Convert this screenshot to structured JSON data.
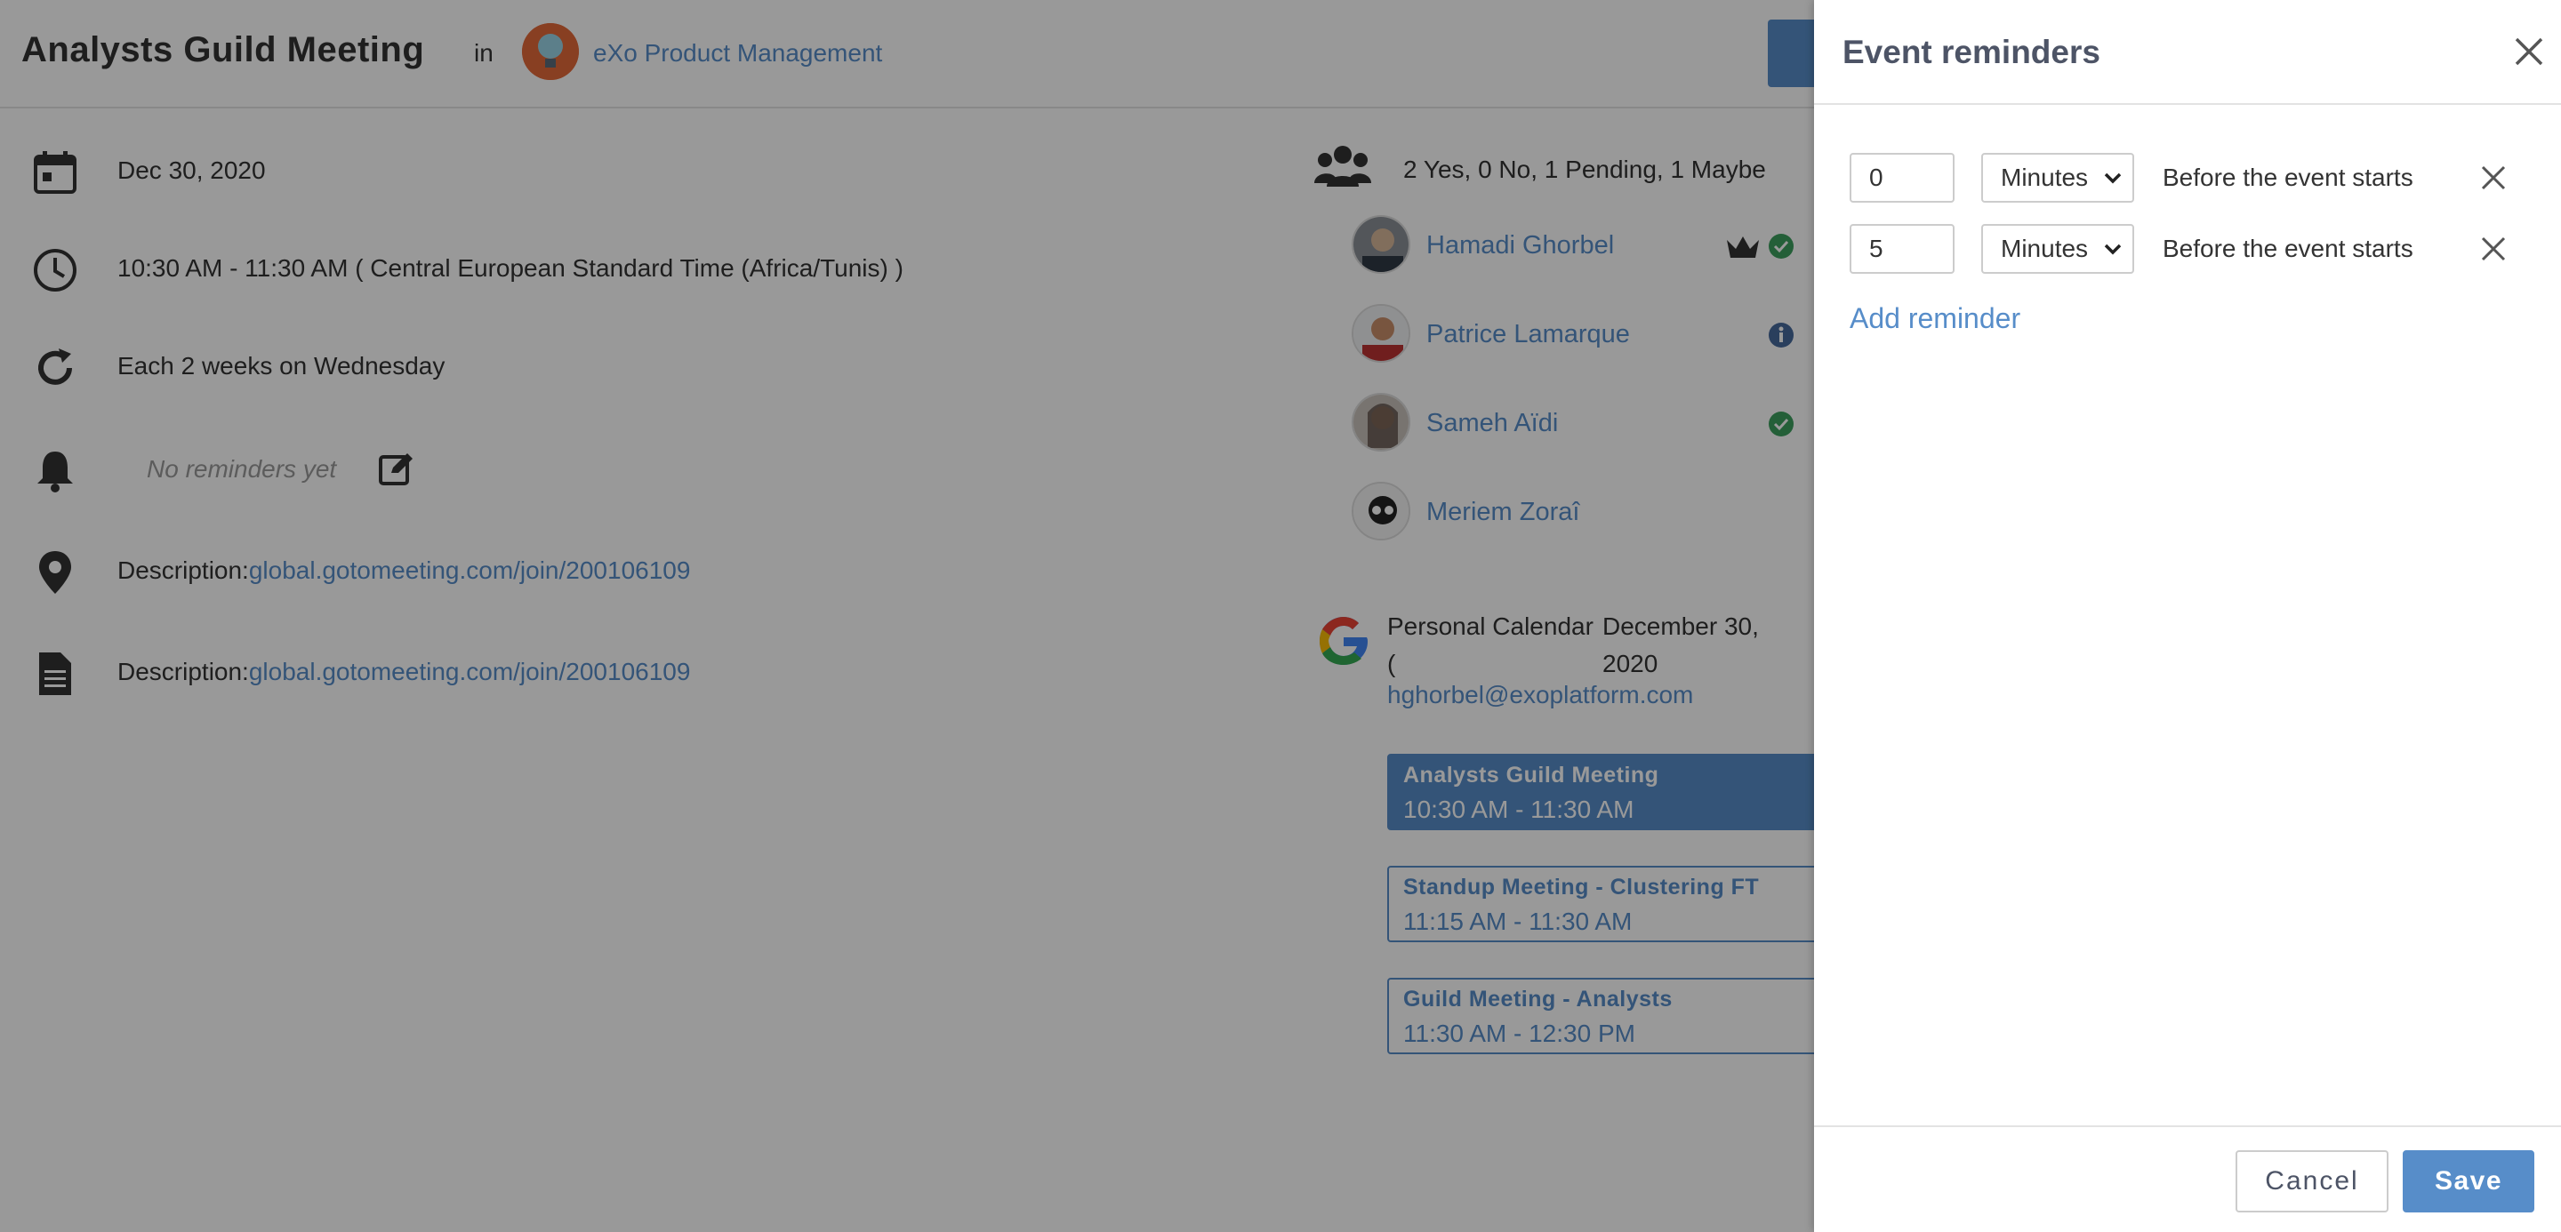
{
  "event": {
    "title": "Analysts Guild Meeting",
    "in_word": "in",
    "space_name": "eXo Product Management",
    "date": "Dec 30, 2020",
    "time": "10:30 AM - 11:30 AM  ( Central European Standard Time (Africa/Tunis) )",
    "recurrence": "Each 2 weeks on Wednesday",
    "no_reminders": "No reminders yet",
    "location_label": "Description:",
    "location_link": "global.gotomeeting.com/join/200106109",
    "description_label": "Description:",
    "description_link": "global.gotomeeting.com/join/200106109"
  },
  "attendees": {
    "summary": "2 Yes, 0 No, 1 Pending, 1 Maybe",
    "list": [
      {
        "name": "Hamadi Ghorbel",
        "status": "yes",
        "organizer": true
      },
      {
        "name": "Patrice Lamarque",
        "status": "maybe",
        "organizer": false
      },
      {
        "name": "Sameh Aïdi",
        "status": "yes",
        "organizer": false
      },
      {
        "name": "Meriem Zoraî",
        "status": "pending",
        "organizer": false
      }
    ]
  },
  "personal_calendar": {
    "name_line1": "Personal Calendar",
    "name_line2": "(",
    "date_line1": "December 30,",
    "date_line2": "2020",
    "email": "hghorbel@exoplatform.com",
    "events": [
      {
        "title": "Analysts Guild Meeting",
        "time": "10:30 AM - 11:30 AM",
        "active": true
      },
      {
        "title": "Standup Meeting - Clustering FT",
        "time": "11:15 AM - 11:30 AM",
        "active": false
      },
      {
        "title": "Guild Meeting - Analysts",
        "time": "11:30 AM - 12:30 PM",
        "active": false
      }
    ]
  },
  "drawer": {
    "title": "Event reminders",
    "reminders": [
      {
        "value": "0",
        "unit": "Minutes",
        "label": "Before the event starts"
      },
      {
        "value": "5",
        "unit": "Minutes",
        "label": "Before the event starts"
      }
    ],
    "add_reminder": "Add reminder",
    "cancel_label": "Cancel",
    "save_label": "Save"
  },
  "colors": {
    "accent": "#578dc9",
    "overlay": "#000000",
    "status_yes": "#3c9e5e",
    "status_maybe": "#476a9c",
    "space_avatar": "#e36a3a"
  }
}
